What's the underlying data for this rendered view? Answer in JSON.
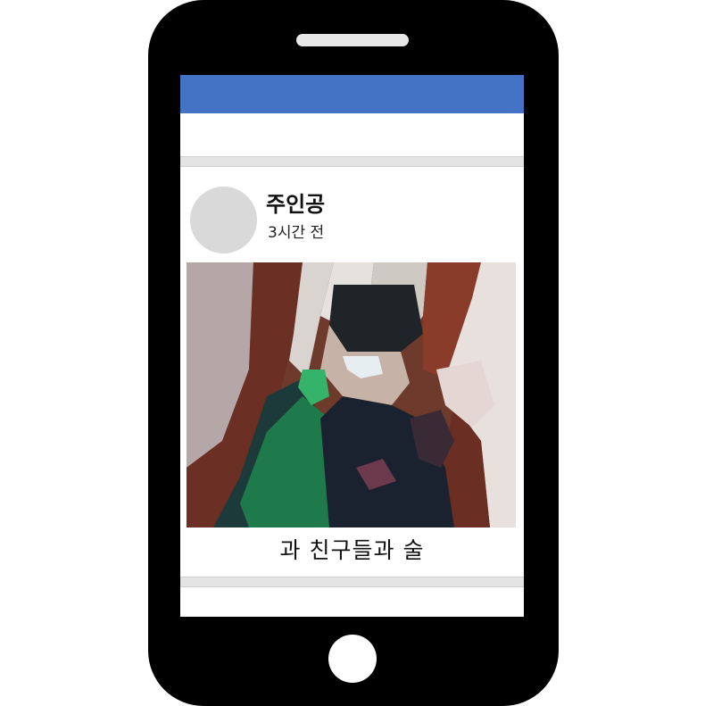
{
  "post": {
    "author": "주인공",
    "time": "3시간 전",
    "caption": "과 친구들과 술"
  },
  "colors": {
    "header": "#4472c4",
    "avatar": "#d9d9d9",
    "divider": "#e4e4e4"
  }
}
